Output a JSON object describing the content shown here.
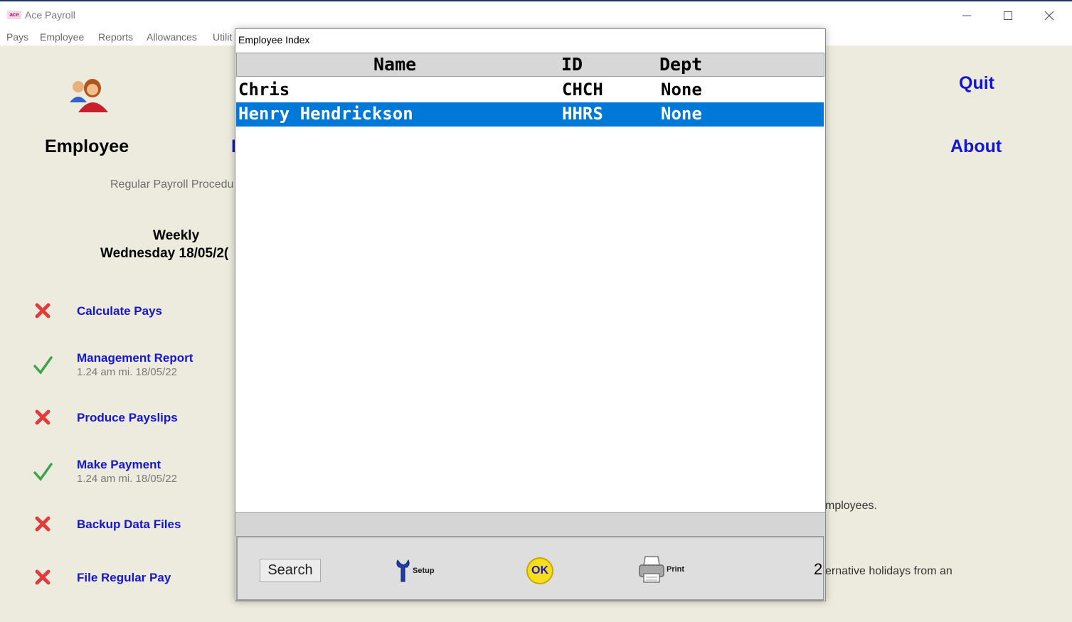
{
  "window": {
    "title": "Ace Payroll",
    "logo_text": "ace"
  },
  "menu": [
    "Pays",
    "Employee",
    "Reports",
    "Allowances",
    "Utilit"
  ],
  "main": {
    "employee_label": "Employee",
    "cut_label": "I",
    "regular_procedure": "Regular Payroll Procedu",
    "frequency": "Weekly",
    "pay_date": "Wednesday 18/05/2(",
    "steps": [
      {
        "label": "Calculate Pays",
        "status": "pending",
        "time": ""
      },
      {
        "label": "Management Report",
        "status": "done",
        "time": "1.24 am mi. 18/05/22"
      },
      {
        "label": "Produce Payslips",
        "status": "pending",
        "time": ""
      },
      {
        "label": "Make Payment",
        "status": "done",
        "time": "1.24 am mi. 18/05/22"
      },
      {
        "label": "Backup Data Files",
        "status": "pending",
        "time": ""
      },
      {
        "label": "File Regular Pay",
        "status": "pending",
        "time": ""
      }
    ],
    "quit": "Quit",
    "about": "About",
    "partial_employees": "mployees.",
    "partial_holidays": "ernative holidays from an"
  },
  "dialog": {
    "title": "Employee Index",
    "columns": [
      "Name",
      "ID",
      "Dept"
    ],
    "rows": [
      {
        "name": "Chris",
        "id": "CHCH",
        "dept": "None",
        "selected": false
      },
      {
        "name": "Henry Hendrickson",
        "id": "HHRS",
        "dept": "None",
        "selected": true
      }
    ],
    "buttons": {
      "search": "Search",
      "setup": "Setup",
      "ok": "OK",
      "print": "Print"
    },
    "count": "2"
  },
  "colors": {
    "link_blue": "#1515d4",
    "selection": "#0078d7",
    "background": "#ecebdd"
  }
}
